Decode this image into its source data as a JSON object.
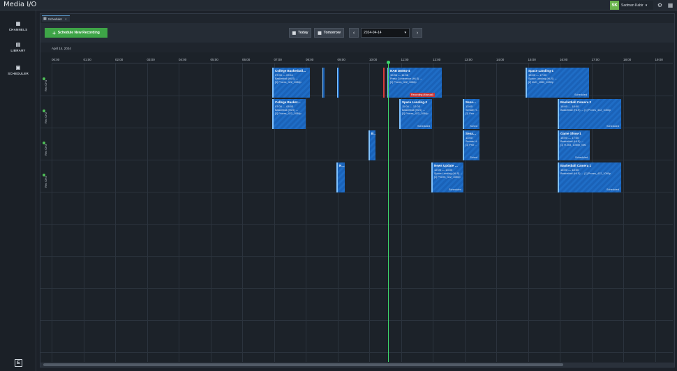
{
  "app": {
    "brand": "Media I/O"
  },
  "user": {
    "initials": "SK",
    "name": "Sadman Kabir"
  },
  "sidebar": {
    "items": [
      {
        "label": "CHANNELS",
        "icon": "channels-icon"
      },
      {
        "label": "LIBRARY",
        "icon": "library-icon"
      },
      {
        "label": "SCHEDULER",
        "icon": "scheduler-icon"
      }
    ]
  },
  "tab": {
    "label": "Scheduler",
    "close": "×"
  },
  "toolbar": {
    "new_recording": "Schedule New Recording",
    "today": "Today",
    "tomorrow": "Tomorrow",
    "date": "2024-04-14",
    "prev": "‹",
    "next": "›"
  },
  "timeline": {
    "date_label": "April 14, 2024",
    "hours": [
      "00:00",
      "01:00",
      "02:00",
      "03:00",
      "04:00",
      "05:00",
      "06:00",
      "07:00",
      "08:00",
      "09:00",
      "10:00",
      "11:00",
      "12:00",
      "13:00",
      "14:00",
      "15:00",
      "16:00",
      "17:00",
      "18:00",
      "19:00"
    ]
  },
  "channels": [
    {
      "name": "Rec CH1"
    },
    {
      "name": "Rec CH2"
    },
    {
      "name": "Rec CH3"
    },
    {
      "name": "Rec CH4"
    }
  ],
  "events": {
    "e1": {
      "title": "College Basketball…",
      "time": "07:00 — 09:11",
      "detail1": "Basketball (HLS) →",
      "detail2": "[1] Prores_422_1080p"
    },
    "e2": {
      "title": "NAB DEMO-4",
      "time": "10:36 — 11:36",
      "detail1": "Press Conference (HLS) →",
      "detail2": "[1] Prores_422_1080p",
      "status": "Recording (Manual)"
    },
    "e3": {
      "title": "Space Landing-1",
      "time": "15:00 — 17:00",
      "detail1": "Space Landing (HLS) →",
      "detail2": "[2] AVC_1080_1080p",
      "status": "Scheduled"
    },
    "e4": {
      "title": "College Basket…",
      "time": "07:00 — 08:03",
      "detail1": "Basketball (HLS) →",
      "detail2": "[1] Prores_422_1080p"
    },
    "e5": {
      "title": "Space Landing-2",
      "time": "11:00 — 12:03",
      "detail1": "Basketball (HLS) →",
      "detail2": "[1] Prores_422_1080p",
      "status": "Scheduled"
    },
    "e6": {
      "title": "Sena…",
      "time": "13:00",
      "detail1": "Senate H…",
      "detail2": "[1] Pror…",
      "status": "Sched"
    },
    "e7": {
      "title": "Basketball Camera 2",
      "time": "16:00 — 18:00",
      "detail1": "Basketball (HLS) → [1] Prores_422_1080p",
      "status": "Scheduled"
    },
    "e8": {
      "title": "Sena…",
      "time": "13:00",
      "detail1": "Senate H…",
      "detail2": "[1] Pror…",
      "status": "Sched"
    },
    "e9": {
      "title": "Game Show-1",
      "time": "16:00 — 17:00",
      "detail1": "Basketball (HLS) →",
      "detail2": "[1] H.264_1080p_Mai",
      "status": "Scheduled"
    },
    "e10": {
      "title": "News Update …",
      "time": "12:00 — 13:00",
      "detail1": "Space Landing (HLS) →",
      "detail2": "[1] Prores_422_1080p",
      "status": "Scheduled"
    },
    "e11": {
      "title": "Basketball Camera 1",
      "time": "16:00 — 18:00",
      "detail1": "Basketball (HLS) → [1] Prores_422_1080p",
      "status": "Scheduled"
    },
    "s1": {
      "title": "B…"
    },
    "s2": {
      "title": "N…"
    }
  }
}
